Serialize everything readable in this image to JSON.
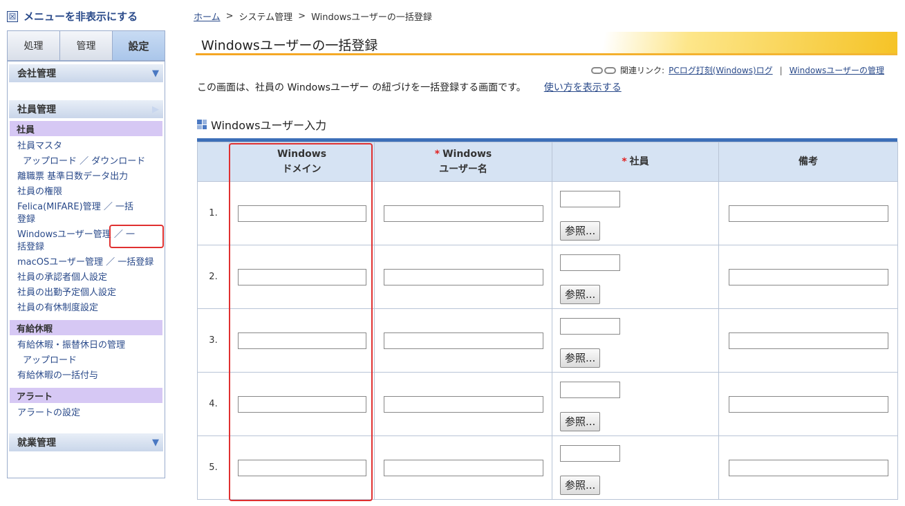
{
  "sidebar": {
    "hide_menu_icon": "☒",
    "hide_menu_label": "メニューを非表示にする",
    "tabs": [
      {
        "label": "処理",
        "active": false
      },
      {
        "label": "管理",
        "active": false
      },
      {
        "label": "設定",
        "active": true
      }
    ],
    "sections": {
      "company": {
        "label": "会社管理",
        "arrow": "▼"
      },
      "employee": {
        "label": "社員管理",
        "arrow": "▶"
      },
      "work": {
        "label": "就業管理",
        "arrow": "▼"
      }
    },
    "groups": {
      "employee": {
        "label": "社員",
        "items": [
          "社員マスタ",
          "アップロード ／ ダウンロード",
          "離職票 基準日数データ出力",
          "社員の権限",
          "Felica(MIFARE)管理 ／ 一括登録",
          "Windowsユーザー管理 ／ 一括登録",
          "macOSユーザー管理 ／ 一括登録",
          "社員の承認者個人設定",
          "社員の出勤予定個人設定",
          "社員の有休制度設定"
        ]
      },
      "paid_leave": {
        "label": "有給休暇",
        "items": [
          "有給休暇・振替休日の管理",
          "アップロード",
          "有給休暇の一括付与"
        ]
      },
      "alert": {
        "label": "アラート",
        "items": [
          "アラートの設定"
        ]
      }
    }
  },
  "breadcrumb": {
    "home": "ホーム",
    "sep": ">",
    "system": "システム管理",
    "current": "Windowsユーザーの一括登録"
  },
  "page_title": "Windowsユーザーの一括登録",
  "related": {
    "label": "関連リンク:",
    "links": [
      "PCログ打刻(Windows)ログ",
      "Windowsユーザーの管理"
    ],
    "sep": "|"
  },
  "description": {
    "text": "この画面は、社員の Windowsユーザー の紐づけを一括登録する画面です。",
    "help_link": "使い方を表示する"
  },
  "section_title": "Windowsユーザー入力",
  "table": {
    "headers": {
      "domain_line1": "Windows",
      "domain_line2": "ドメイン",
      "required_mark": "*",
      "user_line1": "Windows",
      "user_line2": "ユーザー名",
      "employee": "社員",
      "remarks": "備考"
    },
    "browse_label": "参照...",
    "rows": [
      {
        "num": "1.",
        "domain": "",
        "user": "",
        "employee": "",
        "remarks": ""
      },
      {
        "num": "2.",
        "domain": "",
        "user": "",
        "employee": "",
        "remarks": ""
      },
      {
        "num": "3.",
        "domain": "",
        "user": "",
        "employee": "",
        "remarks": ""
      },
      {
        "num": "4.",
        "domain": "",
        "user": "",
        "employee": "",
        "remarks": ""
      },
      {
        "num": "5.",
        "domain": "",
        "user": "",
        "employee": "",
        "remarks": ""
      }
    ]
  },
  "colors": {
    "accent_blue": "#3d6fb8",
    "header_bg": "#d6e3f3",
    "highlight_red": "#e03030",
    "title_gold": "#f5c326",
    "subhead_purple": "#d6c8f4"
  }
}
